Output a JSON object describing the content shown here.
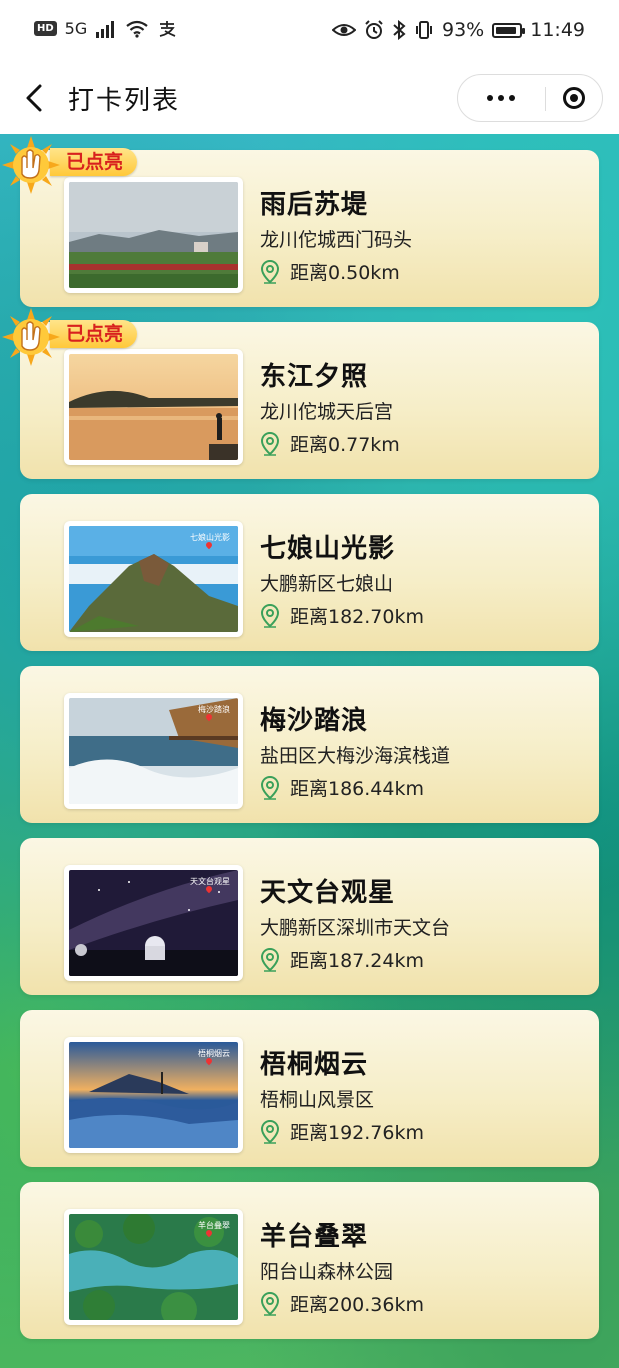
{
  "status_bar": {
    "hd": "HD",
    "network": "5G",
    "battery_percent": "93%",
    "battery_level": 0.93,
    "time": "11:49"
  },
  "nav": {
    "title": "打卡列表",
    "back_icon": "chevron-left-icon",
    "more_icon": "more-dots-icon",
    "close_icon": "record-target-icon"
  },
  "colors": {
    "card_bg_top": "#fbf7e4",
    "card_bg_bottom": "#f1e2ac",
    "badge_text": "#d8211e",
    "badge_bg": "#ffc93a",
    "pin": "#3aa05a"
  },
  "cards": [
    {
      "title": "雨后苏堤",
      "address": "龙川佗城西门码头",
      "distance": "距离0.50km",
      "lit": true,
      "badge": "已点亮",
      "thumb_tag": ""
    },
    {
      "title": "东江夕照",
      "address": "龙川佗城天后宫",
      "distance": "距离0.77km",
      "lit": true,
      "badge": "已点亮",
      "thumb_tag": ""
    },
    {
      "title": "七娘山光影",
      "address": "大鹏新区七娘山",
      "distance": "距离182.70km",
      "lit": false,
      "badge": "",
      "thumb_tag": "七娘山光影"
    },
    {
      "title": "梅沙踏浪",
      "address": "盐田区大梅沙海滨栈道",
      "distance": "距离186.44km",
      "lit": false,
      "badge": "",
      "thumb_tag": "梅沙踏浪"
    },
    {
      "title": "天文台观星",
      "address": "大鹏新区深圳市天文台",
      "distance": "距离187.24km",
      "lit": false,
      "badge": "",
      "thumb_tag": "天文台观星"
    },
    {
      "title": "梧桐烟云",
      "address": "梧桐山风景区",
      "distance": "距离192.76km",
      "lit": false,
      "badge": "",
      "thumb_tag": "梧桐烟云"
    },
    {
      "title": "羊台叠翠",
      "address": "阳台山森林公园",
      "distance": "距离200.36km",
      "lit": false,
      "badge": "",
      "thumb_tag": "羊台叠翠"
    }
  ]
}
